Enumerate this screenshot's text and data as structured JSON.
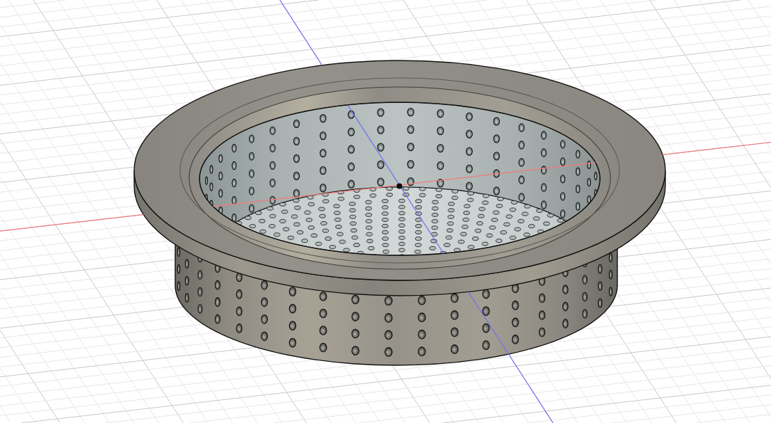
{
  "viewport": {
    "grid": true,
    "axes": true,
    "model": {
      "kind": "perforated-basket"
    }
  }
}
